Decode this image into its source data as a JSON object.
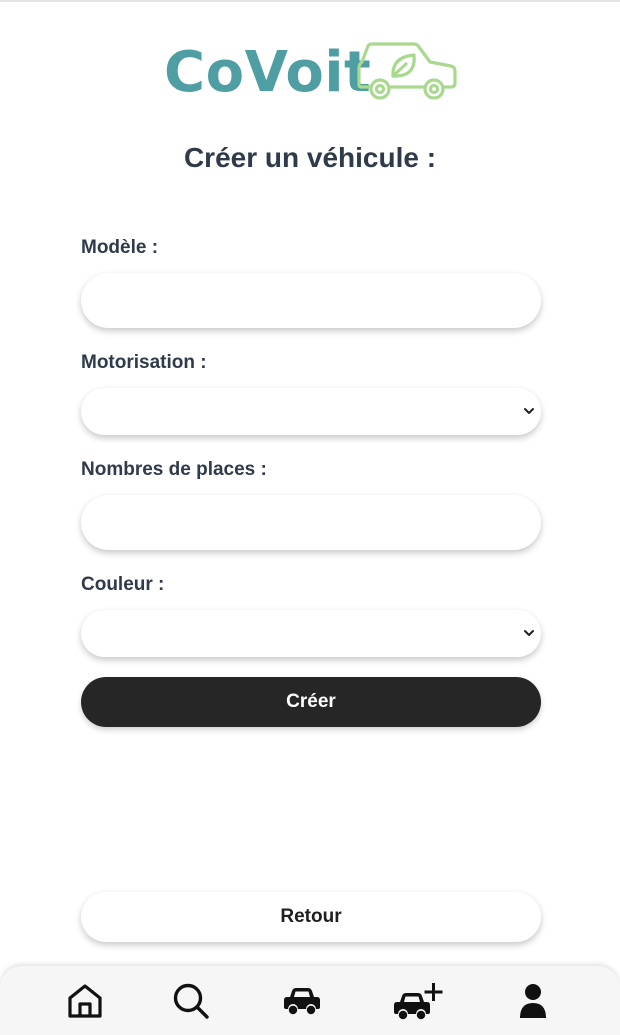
{
  "brand": {
    "name": "CoVoit",
    "text_color": "#4f9ea3",
    "car_color": "#a9d98f"
  },
  "page": {
    "title": "Créer un véhicule :"
  },
  "form": {
    "model": {
      "label": "Modèle :",
      "value": "",
      "placeholder": ""
    },
    "engine": {
      "label": "Motorisation :",
      "selected": ""
    },
    "seats": {
      "label": "Nombres de places :",
      "value": "",
      "placeholder": ""
    },
    "color": {
      "label": "Couleur :",
      "selected": ""
    },
    "submit_label": "Créer"
  },
  "back_label": "Retour",
  "nav": {
    "items": [
      {
        "icon": "home-icon"
      },
      {
        "icon": "search-icon"
      },
      {
        "icon": "car-icon"
      },
      {
        "icon": "add-car-icon"
      },
      {
        "icon": "user-icon"
      }
    ]
  },
  "colors": {
    "primary_button": "#262626",
    "text": "#2f3a4a",
    "nav_background": "#f6f6f6"
  }
}
